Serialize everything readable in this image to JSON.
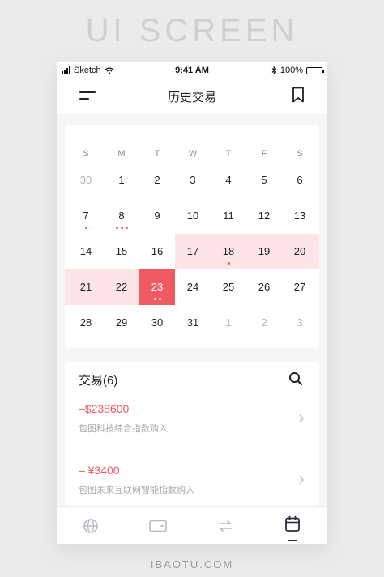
{
  "poster": {
    "title": "UI SCREEN",
    "footer": "IBAOTU.COM"
  },
  "status_bar": {
    "carrier": "Sketch",
    "time": "9:41 AM",
    "battery": "100%",
    "battery_level": 1.0
  },
  "nav": {
    "title": "历史交易",
    "menu_icon": "menu-icon",
    "bookmark_icon": "bookmark-icon"
  },
  "calendar": {
    "weekdays": [
      "S",
      "M",
      "T",
      "W",
      "T",
      "F",
      "S"
    ],
    "weeks": [
      [
        {
          "day": "30",
          "muted": true
        },
        {
          "day": "1"
        },
        {
          "day": "2"
        },
        {
          "day": "3"
        },
        {
          "day": "4"
        },
        {
          "day": "5"
        },
        {
          "day": "6"
        }
      ],
      [
        {
          "day": "7",
          "dots": 1
        },
        {
          "day": "8",
          "dots": 3
        },
        {
          "day": "9"
        },
        {
          "day": "10"
        },
        {
          "day": "11"
        },
        {
          "day": "12"
        },
        {
          "day": "13"
        }
      ],
      [
        {
          "day": "14"
        },
        {
          "day": "15"
        },
        {
          "day": "16"
        },
        {
          "day": "17",
          "highlight": true
        },
        {
          "day": "18",
          "dots": 1,
          "highlight": true
        },
        {
          "day": "19",
          "highlight": true
        },
        {
          "day": "20",
          "highlight": true
        }
      ],
      [
        {
          "day": "21",
          "highlight": true
        },
        {
          "day": "22",
          "highlight": true
        },
        {
          "day": "23",
          "selected": true,
          "dots": 2
        },
        {
          "day": "24"
        },
        {
          "day": "25"
        },
        {
          "day": "26"
        },
        {
          "day": "27"
        }
      ],
      [
        {
          "day": "28"
        },
        {
          "day": "29"
        },
        {
          "day": "30"
        },
        {
          "day": "31"
        },
        {
          "day": "1",
          "muted": true
        },
        {
          "day": "2",
          "muted": true
        },
        {
          "day": "3",
          "muted": true
        }
      ]
    ]
  },
  "transactions": {
    "title": "交易(6)",
    "search_icon": "search-icon",
    "items": [
      {
        "amount": "–$238600",
        "desc": "包图科技综合指数购入"
      },
      {
        "amount": "– ¥3400",
        "desc": "包图未来互联网智能指数购入"
      }
    ]
  },
  "tab_bar": {
    "tabs": [
      {
        "icon": "globe-icon",
        "active": false
      },
      {
        "icon": "wallet-icon",
        "active": false
      },
      {
        "icon": "transfer-icon",
        "active": false
      },
      {
        "icon": "calendar-icon",
        "active": true
      }
    ]
  },
  "colors": {
    "accent": "#f05a62",
    "highlight": "#fde4e6",
    "tab_active": "#2b2b3a",
    "tab_inactive": "#b9b9c3"
  }
}
